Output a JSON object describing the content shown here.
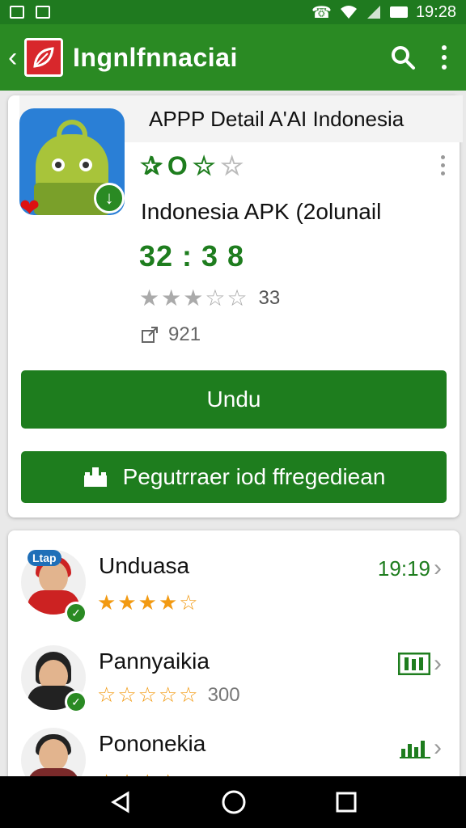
{
  "status_bar": {
    "time": "19:28"
  },
  "app_bar": {
    "title": "Ingnlfnnaciai"
  },
  "detail_card": {
    "header": "APPP Detail A'AI Indonesia",
    "app_name": "Indonesia APK (2olunail",
    "big_number": "32 : 3 8",
    "rating_count": "33",
    "share_count": "921",
    "primary_button": "Undu",
    "secondary_button": "Pegutrraer iod ffregediean"
  },
  "reviews": [
    {
      "name": "Unduasa",
      "stars": 4,
      "right_text": "19:19",
      "icon_badge": "Ltap"
    },
    {
      "name": "Pannyaikia",
      "stars": 0,
      "count": "300"
    },
    {
      "name": "Pononekia"
    }
  ],
  "colors": {
    "primary": "#2a8a23",
    "status": "#1f7a1f",
    "accent_star": "#f29a12"
  }
}
